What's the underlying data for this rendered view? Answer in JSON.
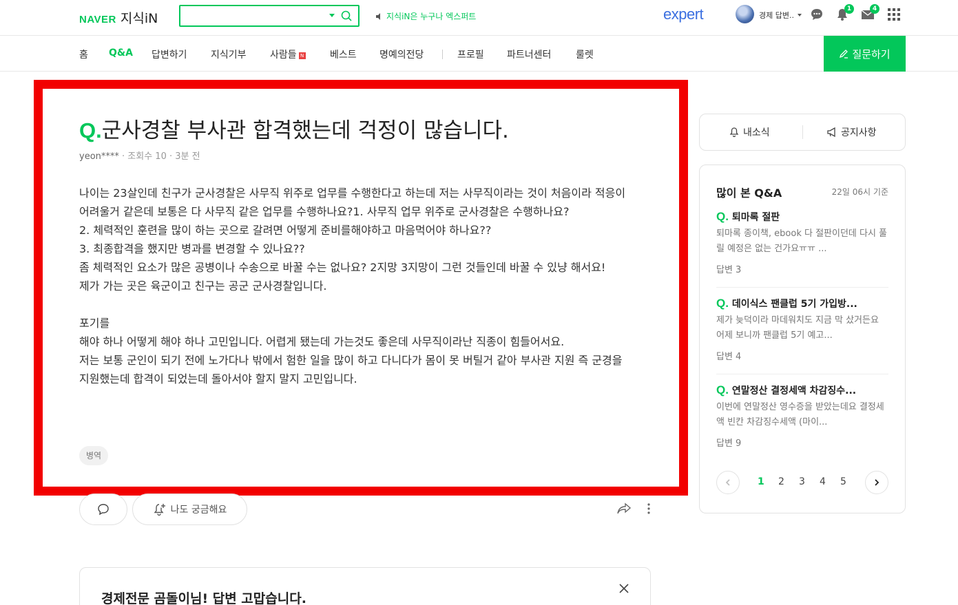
{
  "header": {
    "logo_naver": "NAVER",
    "logo_kin": "지식iN",
    "search_placeholder": "",
    "expert_notice": "지식iN은 누구나 엑스퍼트",
    "expert_logo": "expert",
    "user_name": "경제 답변..",
    "notifications_count": "1",
    "messages_count": "4"
  },
  "nav": {
    "items": [
      "홈",
      "Q&A",
      "답변하기",
      "지식기부",
      "사람들",
      "베스트",
      "명예의전당",
      "프로필",
      "파트너센터",
      "룰렛"
    ],
    "new_badge": "N",
    "ask_button": "질문하기"
  },
  "question": {
    "q_mark": "Q.",
    "title": "군사경찰 부사관 합격했는데 걱정이 많습니다.",
    "author": "yeon****",
    "views": "조회수 10",
    "time": "3분 전",
    "body": "나이는 23살인데 친구가 군사경찰은 사무직 위주로 업무를 수행한다고 하는데 저는 사무직이라는 것이 처음이라 적응이 어려울거 같은데 보통은 다 사무직 같은 업무를 수행하나요?1. 사무직 업무 위주로 군사경찰은 수행하나요?\n2. 체력적인 훈련을 많이 하는 곳으로 갈려면 어떻게 준비를해야하고 마음먹어야 하나요??\n3. 최종합격을 했지만 병과를 변경할 수 있나요??\n좀 체력적인 요소가 많은 공병이나 수송으로 바꿀 수는 없나요? 2지망 3지망이 그런 것들인데 바꿀 수 있냥 해서요!\n제가 가는 곳은 육군이고 친구는 공군 군사경찰입니다.\n\n포기를\n해야 하나 어떻게 해야 하나 고민입니다. 어렵게 됐는데 가는것도 좋은데 사무직이라난 직종이 힘들어서요.\n저는 보통 군인이 되기 전에 노가다나 밖에서 험한 일을 많이 하고 다니다가 몸이 못 버틸거 같아 부사관 지원 즉 군경을 지원했는데 합격이 되었는데 돌아서야 할지 말지 고민입니다.",
    "tag": "병역",
    "curious_button": "나도 궁금해요"
  },
  "answer_card": {
    "title": "경제전문 곰돌이님! 답변 고맙습니다."
  },
  "sidebar": {
    "tab_news": "내소식",
    "tab_notice": "공지사항",
    "popular_title": "많이 본 Q&A",
    "popular_time": "22일 06시 기준",
    "q_mark": "Q.",
    "items": [
      {
        "title": "퇴마록 절판",
        "desc": "퇴마록 종이책, ebook 다 절판이던데 다시 풀릴 예정은 없는 건가요ㅠㅠ ...",
        "answers": "답변 3"
      },
      {
        "title": "데이식스 팬클럽 5기 가입방...",
        "desc": "제가 늦덕이라 마데워치도 지금 막 샀거든요 어제 보니까 팬클럽 5기 예고...",
        "answers": "답변 4"
      },
      {
        "title": "연말정산 결정세액 차감징수...",
        "desc": "이번에 연말정산 영수증을 받았는데요 결정세액 빈칸 차감징수세액 (마이...",
        "answers": "답변 9"
      }
    ],
    "pages": [
      "1",
      "2",
      "3",
      "4",
      "5"
    ],
    "current_page": "1"
  }
}
